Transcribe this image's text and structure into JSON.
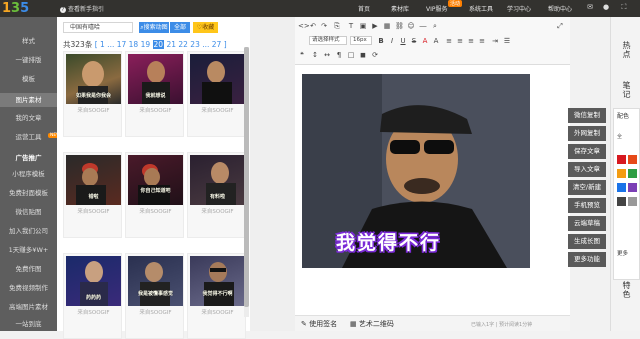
{
  "topbar": {
    "help": "查看新手指引",
    "nav": [
      "首页",
      "素材库",
      "VIP服务",
      "系统工具",
      "学习中心",
      "帮助中心"
    ],
    "vip_badge": "活动"
  },
  "sidebar": {
    "items": [
      {
        "label": "样式"
      },
      {
        "label": "一键排版"
      },
      {
        "label": "模板"
      },
      {
        "label": "图片素材",
        "active": true
      },
      {
        "label": "我的文章"
      },
      {
        "label": "运营工具",
        "badge": "NEW"
      },
      {
        "label": "广告推广"
      },
      {
        "label": "小程序模板"
      },
      {
        "label": "免费封面模板"
      },
      {
        "label": "微信贴图"
      },
      {
        "label": "加入我们公司"
      },
      {
        "label": "1天赚多¥W+"
      },
      {
        "label": "免费作图"
      },
      {
        "label": "免费视频制作"
      },
      {
        "label": "高端图片素材"
      },
      {
        "label": "一站到底"
      }
    ]
  },
  "panel": {
    "search_value": "中国有嘻哈",
    "search_button": "搜索动图",
    "all_button": "全部",
    "fav_button": "收藏",
    "pager_total": "共323条",
    "pager_pre": "[ 1 ... 17 18 19",
    "pager_current": "20",
    "pager_post": "21 22 23 ... 27 ]",
    "cards": [
      {
        "caption": "来自SOOGIF",
        "overlay": "如果我是你我会"
      },
      {
        "caption": "来自SOOGIF",
        "overlay": "我就想说"
      },
      {
        "caption": "来自SOOGIF",
        "overlay": ""
      },
      {
        "caption": "来自SOOGIF",
        "overlay": "错啦"
      },
      {
        "caption": "来自SOOGIF",
        "overlay": "你自己知道吧"
      },
      {
        "caption": "来自SOOGIF",
        "overlay": "有料啦"
      },
      {
        "caption": "来自SOOGIF",
        "overlay": "药药药"
      },
      {
        "caption": "来自SOOGIF",
        "overlay": "我是被懂事感觉"
      },
      {
        "caption": "来自SOOGIF",
        "overlay": "我觉得不行啊"
      }
    ]
  },
  "editor": {
    "style_select": "请选择样式",
    "size_select": "16px",
    "canvas_text": "我觉得不行",
    "tab_signature": "使用签名",
    "tab_qrcode": "艺术二维码",
    "status_info": "已输入1字 | 预计阅读1分钟"
  },
  "actions": [
    "微信复制",
    "外网复制",
    "保存文章",
    "导入文章",
    "清空/新建",
    "手机预览",
    "云端草稿",
    "生成长图",
    "更多功能"
  ],
  "right": {
    "hot": "热点",
    "notes": "笔记",
    "color_title": "配色",
    "color_toggle": "全",
    "more": "更多",
    "special": "特色"
  },
  "colors": {
    "accent": "#3c8ce7",
    "vip": "#ff7f00",
    "swatches": [
      "#d71920",
      "#e64a19",
      "#f39c12",
      "#2e9e44",
      "#1a73e8",
      "#7b3fb5",
      "#444444",
      "#999999"
    ]
  }
}
